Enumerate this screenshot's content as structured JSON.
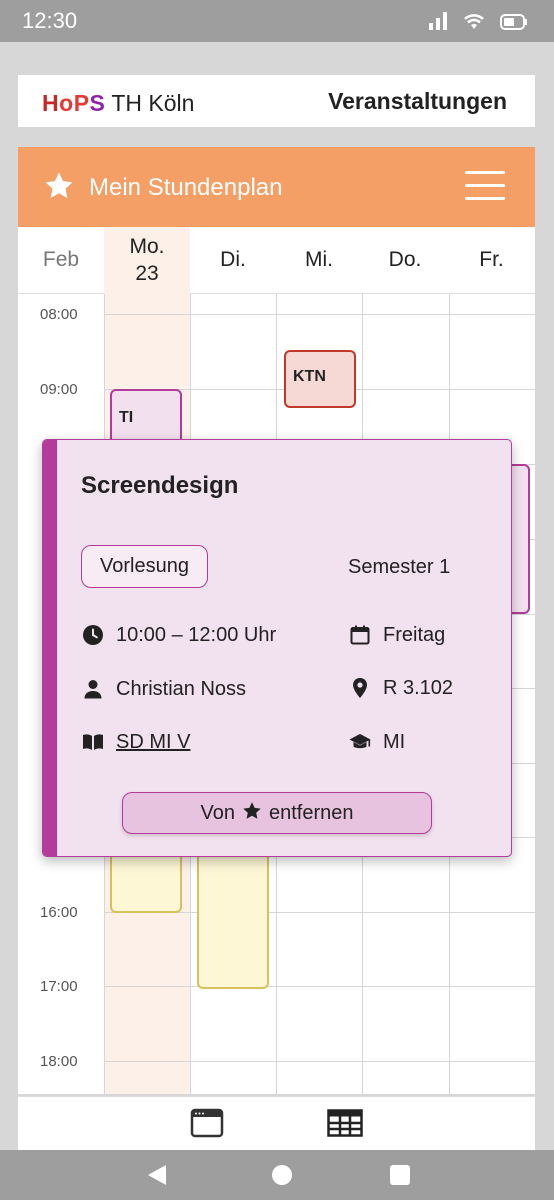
{
  "status_bar": {
    "time": "12:30"
  },
  "header": {
    "logo_hops": [
      "H",
      "o",
      "P",
      "S"
    ],
    "logo_uni": "TH Köln",
    "nav_link": "Veranstaltungen"
  },
  "plan_bar": {
    "title": "Mein Stundenplan",
    "icon": "star-icon"
  },
  "days": {
    "month": "Feb",
    "columns": [
      {
        "name": "Mo.",
        "date": "23"
      },
      {
        "name": "Di.",
        "date": ""
      },
      {
        "name": "Mi.",
        "date": ""
      },
      {
        "name": "Do.",
        "date": ""
      },
      {
        "name": "Fr.",
        "date": ""
      }
    ]
  },
  "hours": [
    "08:00",
    "09:00",
    "16:00",
    "17:00",
    "18:00"
  ],
  "events": [
    {
      "label": "TI",
      "day": "Mo."
    },
    {
      "label": "KTN",
      "day": "Mi."
    }
  ],
  "popup": {
    "title": "Screendesign",
    "type": "Vorlesung",
    "semester": "Semester 1",
    "time": "10:00 – 12:00 Uhr",
    "weekday": "Freitag",
    "lecturer": "Christian Noss",
    "room": "R 3.102",
    "module_code": "SD MI V",
    "program": "MI",
    "remove_prefix": "Von",
    "remove_suffix": "entfernen"
  },
  "colors": {
    "accent_orange": "#f39f65",
    "popup_bg": "#f2e1ee",
    "popup_accent": "#b33b9b",
    "today_bg": "#fdf0e8"
  }
}
